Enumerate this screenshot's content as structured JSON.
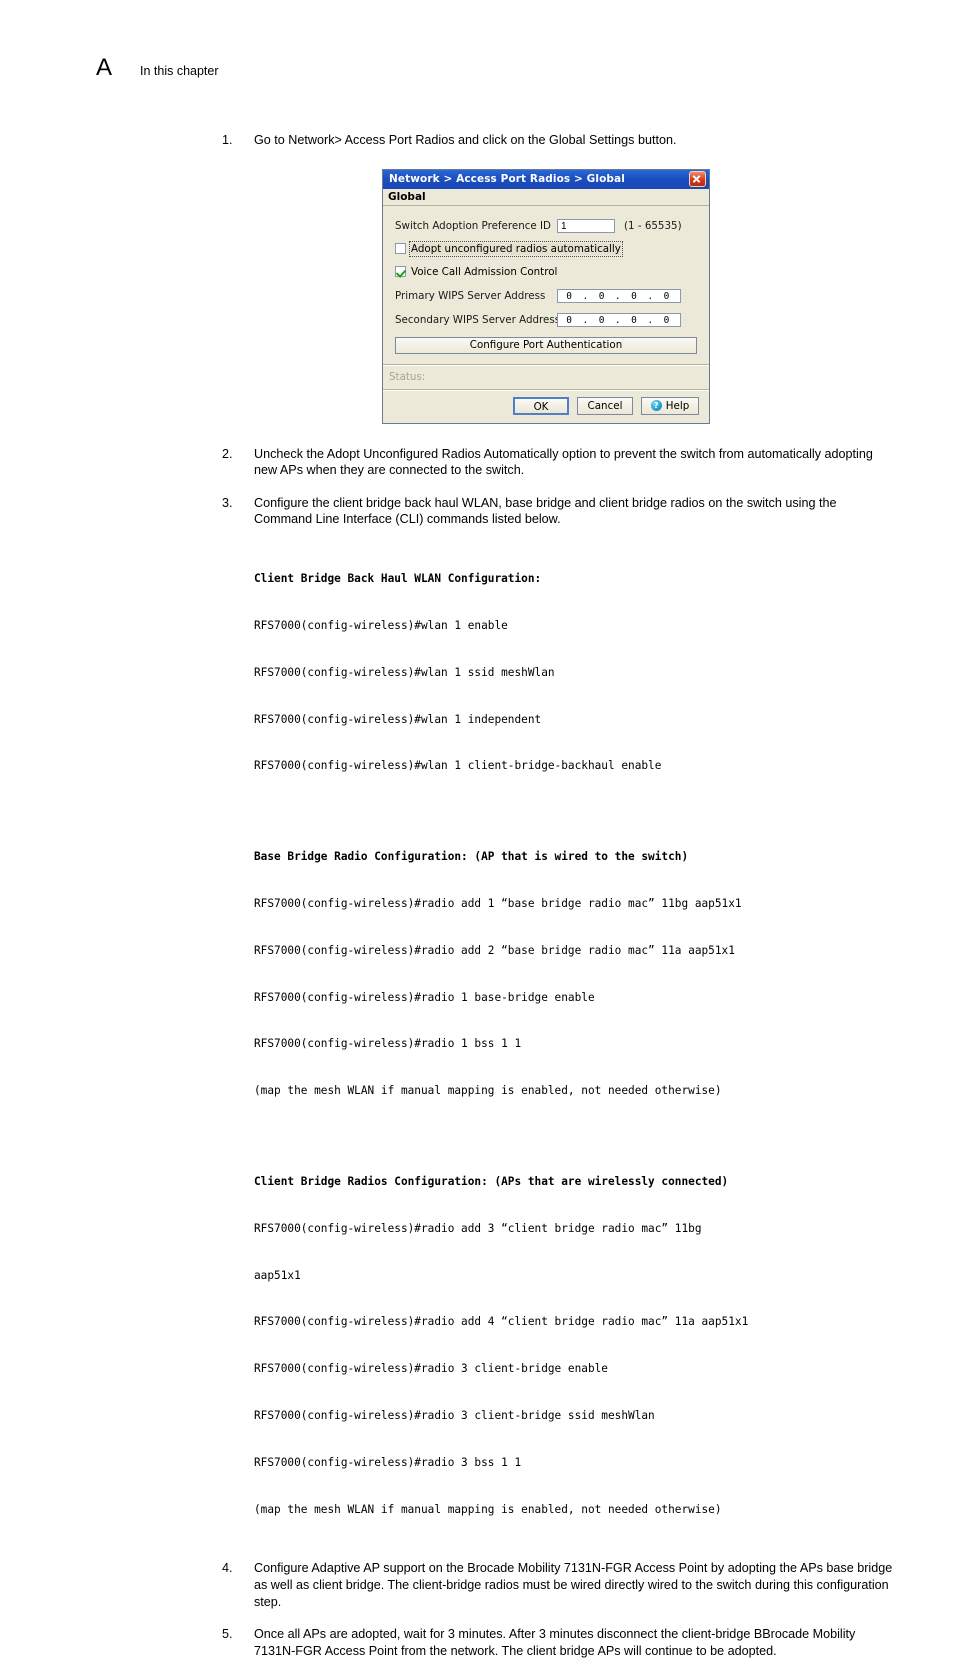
{
  "page": {
    "chapter_letter": "A",
    "chapter_caption": "In this chapter"
  },
  "steps": {
    "step1": {
      "num": "1.",
      "text": "Go to Network> Access Port Radios and click on the Global Settings button."
    },
    "step2": {
      "num": "2.",
      "text": "Uncheck the Adopt Unconfigured Radios Automatically option to prevent the switch from automatically adopting new APs when they are connected to the switch."
    },
    "step3": {
      "num": "3.",
      "text": "Configure the client bridge back haul WLAN, base bridge and client bridge radios on the switch using the Command Line Interface (CLI) commands listed below."
    },
    "step4": {
      "num": "4.",
      "text": "Configure Adaptive AP support on the Brocade Mobility 7131N-FGR Access Point by adopting the APs base bridge as well as client bridge. The client-bridge radios must be wired directly wired to the switch during this configuration step."
    },
    "step5": {
      "num": "5.",
      "text": "Once all APs are adopted, wait for 3 minutes. After 3 minutes disconnect the client-bridge BBrocade Mobility 7131N-FGR Access Point from the network. The client bridge APs will continue to be adopted."
    }
  },
  "dialog": {
    "titlebar": "Network > Access Port Radios > Global",
    "close_icon": "close-icon",
    "section_title": "Global",
    "pref_id_label": "Switch Adoption Preference ID",
    "pref_id_value": "1",
    "pref_id_range": "(1 - 65535)",
    "adopt_checkbox_label": "Adopt unconfigured radios automatically",
    "adopt_checkbox_checked": false,
    "voice_checkbox_label": "Voice Call Admission Control",
    "voice_checkbox_checked": true,
    "primary_wips_label": "Primary WIPS Server Address",
    "primary_wips_value": "0 . 0 . 0 . 0",
    "secondary_wips_label": "Secondary WIPS Server Address",
    "secondary_wips_value": "0 . 0 . 0 . 0",
    "configure_port_auth_label": "Configure Port Authentication",
    "status_label": "Status:",
    "ok_label": "OK",
    "cancel_label": "Cancel",
    "help_label": "Help",
    "help_icon_glyph": "?",
    "colors": {
      "titlebar_blue": "#1c4fc0",
      "close_red": "#d93a1a",
      "panel_beige": "#ece9d8",
      "check_green": "#19a319",
      "help_blue": "#1f9fd4"
    }
  },
  "cli": {
    "block1": {
      "title": "Client Bridge Back Haul WLAN Configuration:",
      "lines": [
        "RFS7000(config-wireless)#wlan 1 enable",
        "RFS7000(config-wireless)#wlan 1 ssid meshWlan",
        "RFS7000(config-wireless)#wlan 1 independent",
        "RFS7000(config-wireless)#wlan 1 client-bridge-backhaul enable"
      ]
    },
    "block2": {
      "title": "Base Bridge Radio Configuration: (AP that is wired to the switch)",
      "lines": [
        "RFS7000(config-wireless)#radio add 1 “base bridge radio mac” 11bg aap51x1",
        "RFS7000(config-wireless)#radio add 2 “base bridge radio mac” 11a aap51x1",
        "RFS7000(config-wireless)#radio 1 base-bridge enable",
        "RFS7000(config-wireless)#radio 1 bss 1 1",
        "(map the mesh WLAN if manual mapping is enabled, not needed otherwise)"
      ]
    },
    "block3": {
      "title": "Client Bridge Radios Configuration: (APs that are wirelessly connected)",
      "lines": [
        "RFS7000(config-wireless)#radio add 3 “client bridge radio mac” 11bg",
        "aap51x1",
        "RFS7000(config-wireless)#radio add 4 “client bridge radio mac” 11a aap51x1",
        "RFS7000(config-wireless)#radio 3 client-bridge enable",
        "RFS7000(config-wireless)#radio 3 client-bridge ssid meshWlan",
        "RFS7000(config-wireless)#radio 3 bss 1 1",
        "(map the mesh WLAN if manual mapping is enabled, not needed otherwise)"
      ]
    }
  }
}
